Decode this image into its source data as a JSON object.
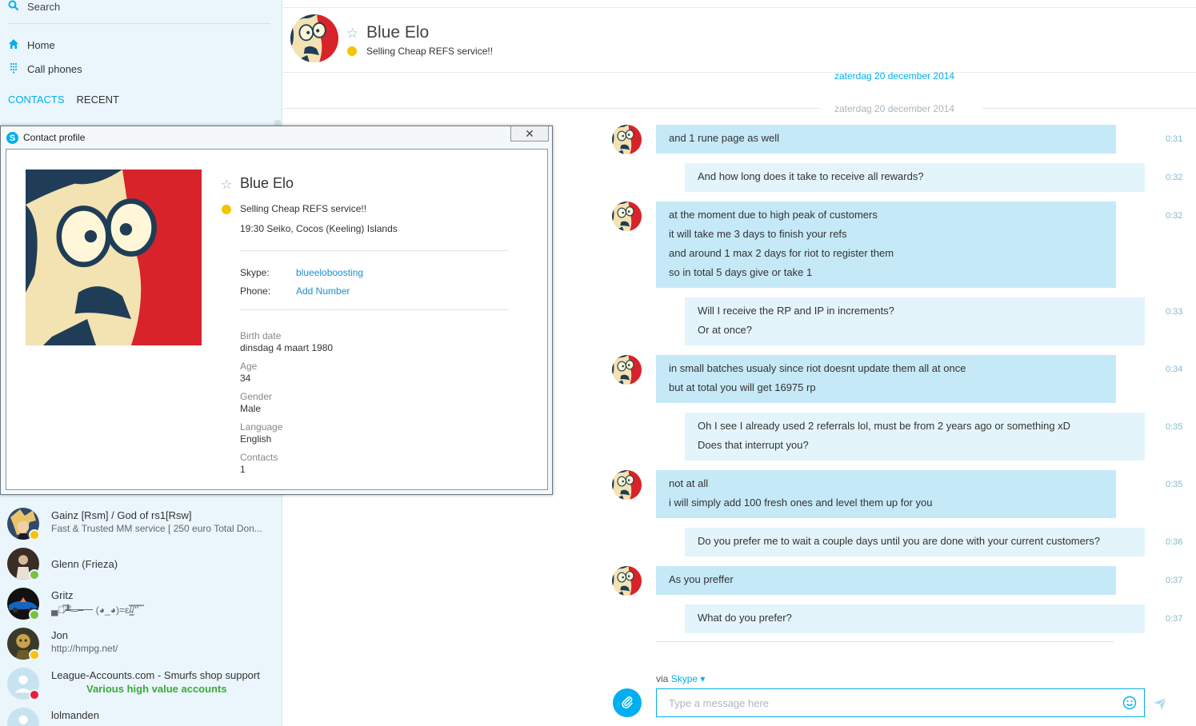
{
  "sidebar": {
    "search_label": "Search",
    "nav": [
      {
        "label": "Home",
        "icon": "home-icon"
      },
      {
        "label": "Call phones",
        "icon": "dialpad-icon"
      }
    ],
    "tabs": [
      {
        "label": "CONTACTS",
        "active": true
      },
      {
        "label": "RECENT",
        "active": false
      }
    ],
    "contacts": [
      {
        "name": "Gainz [Rsm] / God of rs1[Rsw]",
        "mood": "Fast & Trusted MM service [ 250 euro Total Don...",
        "status": "away"
      },
      {
        "name": "Glenn (Frieza)",
        "mood": "",
        "status": "online"
      },
      {
        "name": "Gritz",
        "mood": "▄︻̷̿┻̿═━一 (◕_◕)=ε/̵͇̿̿/’̿’̿ ̿",
        "status": "online"
      },
      {
        "name": "Jon",
        "mood": "http://hmpg.net/",
        "status": "away"
      },
      {
        "name": "League-Accounts.com - Smurfs shop support",
        "mood": "Various high value accounts",
        "status": "busy"
      },
      {
        "name": "lolmanden",
        "mood": "",
        "status": "none"
      }
    ]
  },
  "header": {
    "name": "Blue Elo",
    "mood": "Selling Cheap REFS service!!"
  },
  "date_separators": [
    "zaterdag 20 december 2014",
    "zaterdag 20 december 2014"
  ],
  "messages": [
    {
      "from": "them",
      "lines": [
        "and 1 rune page as well"
      ],
      "time": "0:31"
    },
    {
      "from": "me",
      "lines": [
        "And how long does it take to receive all rewards?"
      ],
      "time": "0:32"
    },
    {
      "from": "them",
      "lines": [
        "at the moment due to high peak of customers",
        "it will take me 3 days to finish your refs",
        "and around 1 max 2 days for riot to register them",
        "so in total 5 days give or take 1"
      ],
      "time": "0:32"
    },
    {
      "from": "me",
      "lines": [
        "Will I receive the RP and IP in increments?",
        "Or at once?"
      ],
      "time": "0:33"
    },
    {
      "from": "them",
      "lines": [
        "in small batches usualy since riot doesnt update them all at once",
        "but at total you will get 16975 rp"
      ],
      "time": "0:34"
    },
    {
      "from": "me",
      "lines": [
        "Oh I see I already used 2 referrals lol, must be from 2 years ago or something xD",
        "Does that interrupt you?"
      ],
      "time": "0:35"
    },
    {
      "from": "them",
      "lines": [
        "not at all",
        "i will simply add 100 fresh ones and level them up for you"
      ],
      "time": "0:35"
    },
    {
      "from": "me",
      "lines": [
        "Do you prefer me to wait a couple days until you are done with your current customers?"
      ],
      "time": "0:36"
    },
    {
      "from": "them",
      "lines": [
        "As you preffer"
      ],
      "time": "0:37"
    },
    {
      "from": "me",
      "lines": [
        "What do you prefer?"
      ],
      "time": "0:37"
    }
  ],
  "composer": {
    "via_prefix": "via",
    "via_service": "Skype",
    "placeholder": "Type a message here"
  },
  "profile_popup": {
    "window_title": "Contact profile",
    "close_glyph": "✕",
    "name": "Blue Elo",
    "mood": "Selling Cheap REFS service!!",
    "local_time": "19:30 Seiko, Cocos (Keeling) Islands",
    "skype_label": "Skype:",
    "skype_value": "blueeloboosting",
    "phone_label": "Phone:",
    "phone_value": "Add Number",
    "birth_label": "Birth date",
    "birth_value": "dinsdag 4 maart 1980",
    "age_label": "Age",
    "age_value": "34",
    "gender_label": "Gender",
    "gender_value": "Male",
    "language_label": "Language",
    "language_value": "English",
    "contacts_label": "Contacts",
    "contacts_value": "1"
  },
  "colors": {
    "accent": "#00aff0",
    "bubble_them": "#c6e9f8",
    "bubble_me": "#e4f4fb",
    "sidebar_bg": "#eaf6fb",
    "status_online": "#7bc043",
    "status_away": "#f5c400",
    "status_busy": "#e81e3c"
  }
}
